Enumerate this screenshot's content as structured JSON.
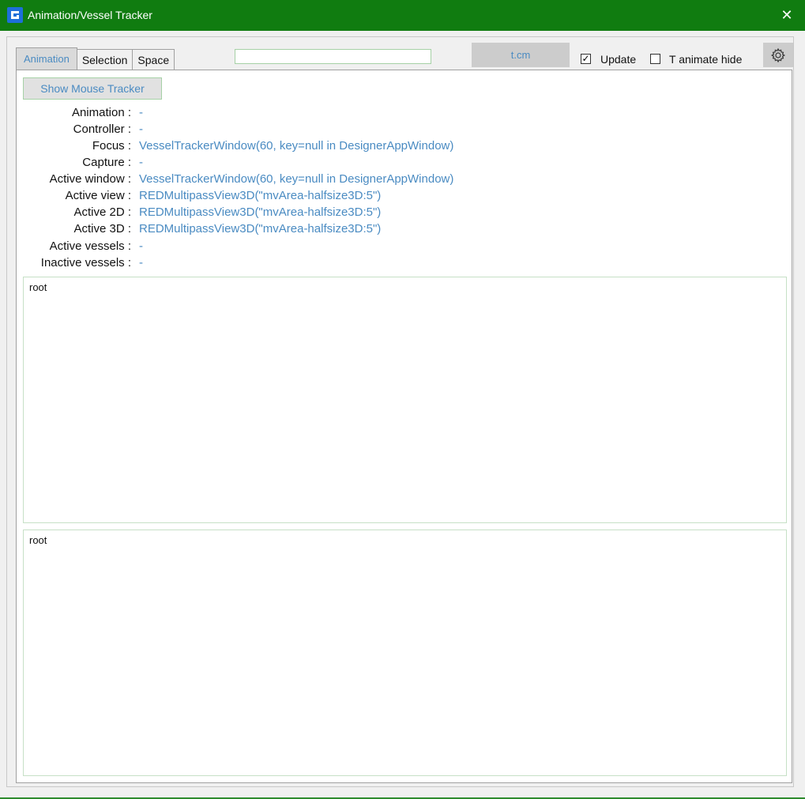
{
  "window": {
    "title": "Animation/Vessel Tracker",
    "close_glyph": "✕",
    "accent_color": "#107c10"
  },
  "tabs": [
    {
      "label": "Animation",
      "active": true
    },
    {
      "label": "Selection",
      "active": false
    },
    {
      "label": "Space",
      "active": false
    }
  ],
  "toolbar": {
    "search_value": "",
    "tcm_label": "t.cm",
    "update_label": "Update",
    "update_checked": true,
    "animate_hide_label": "T animate hide",
    "animate_hide_checked": false,
    "settings_icon": "gear-icon"
  },
  "mouse_tracker_button": "Show Mouse Tracker",
  "info": [
    {
      "label": "Animation :",
      "value": "-"
    },
    {
      "label": "Controller :",
      "value": "-"
    },
    {
      "label": "Focus :",
      "value": "VesselTrackerWindow(60, key=null in DesignerAppWindow)"
    },
    {
      "label": "Capture :",
      "value": "-"
    },
    {
      "label": "Active window :",
      "value": "VesselTrackerWindow(60, key=null in DesignerAppWindow)"
    },
    {
      "label": "Active view :",
      "value": "REDMultipassView3D(\"mvArea-halfsize3D:5\")"
    },
    {
      "label": "Active 2D :",
      "value": "REDMultipassView3D(\"mvArea-halfsize3D:5\")"
    },
    {
      "label": "Active 3D :",
      "value": "REDMultipassView3D(\"mvArea-halfsize3D:5\")"
    },
    {
      "label": "Active vessels :",
      "value": "-"
    },
    {
      "label": "Inactive vessels :",
      "value": "-"
    }
  ],
  "tree_top": {
    "root_label": "root"
  },
  "tree_bottom": {
    "root_label": "root"
  },
  "colors": {
    "link_blue": "#4a8bc2",
    "panel_bg": "#f0f0f0",
    "border_green": "#a6d1a6"
  }
}
